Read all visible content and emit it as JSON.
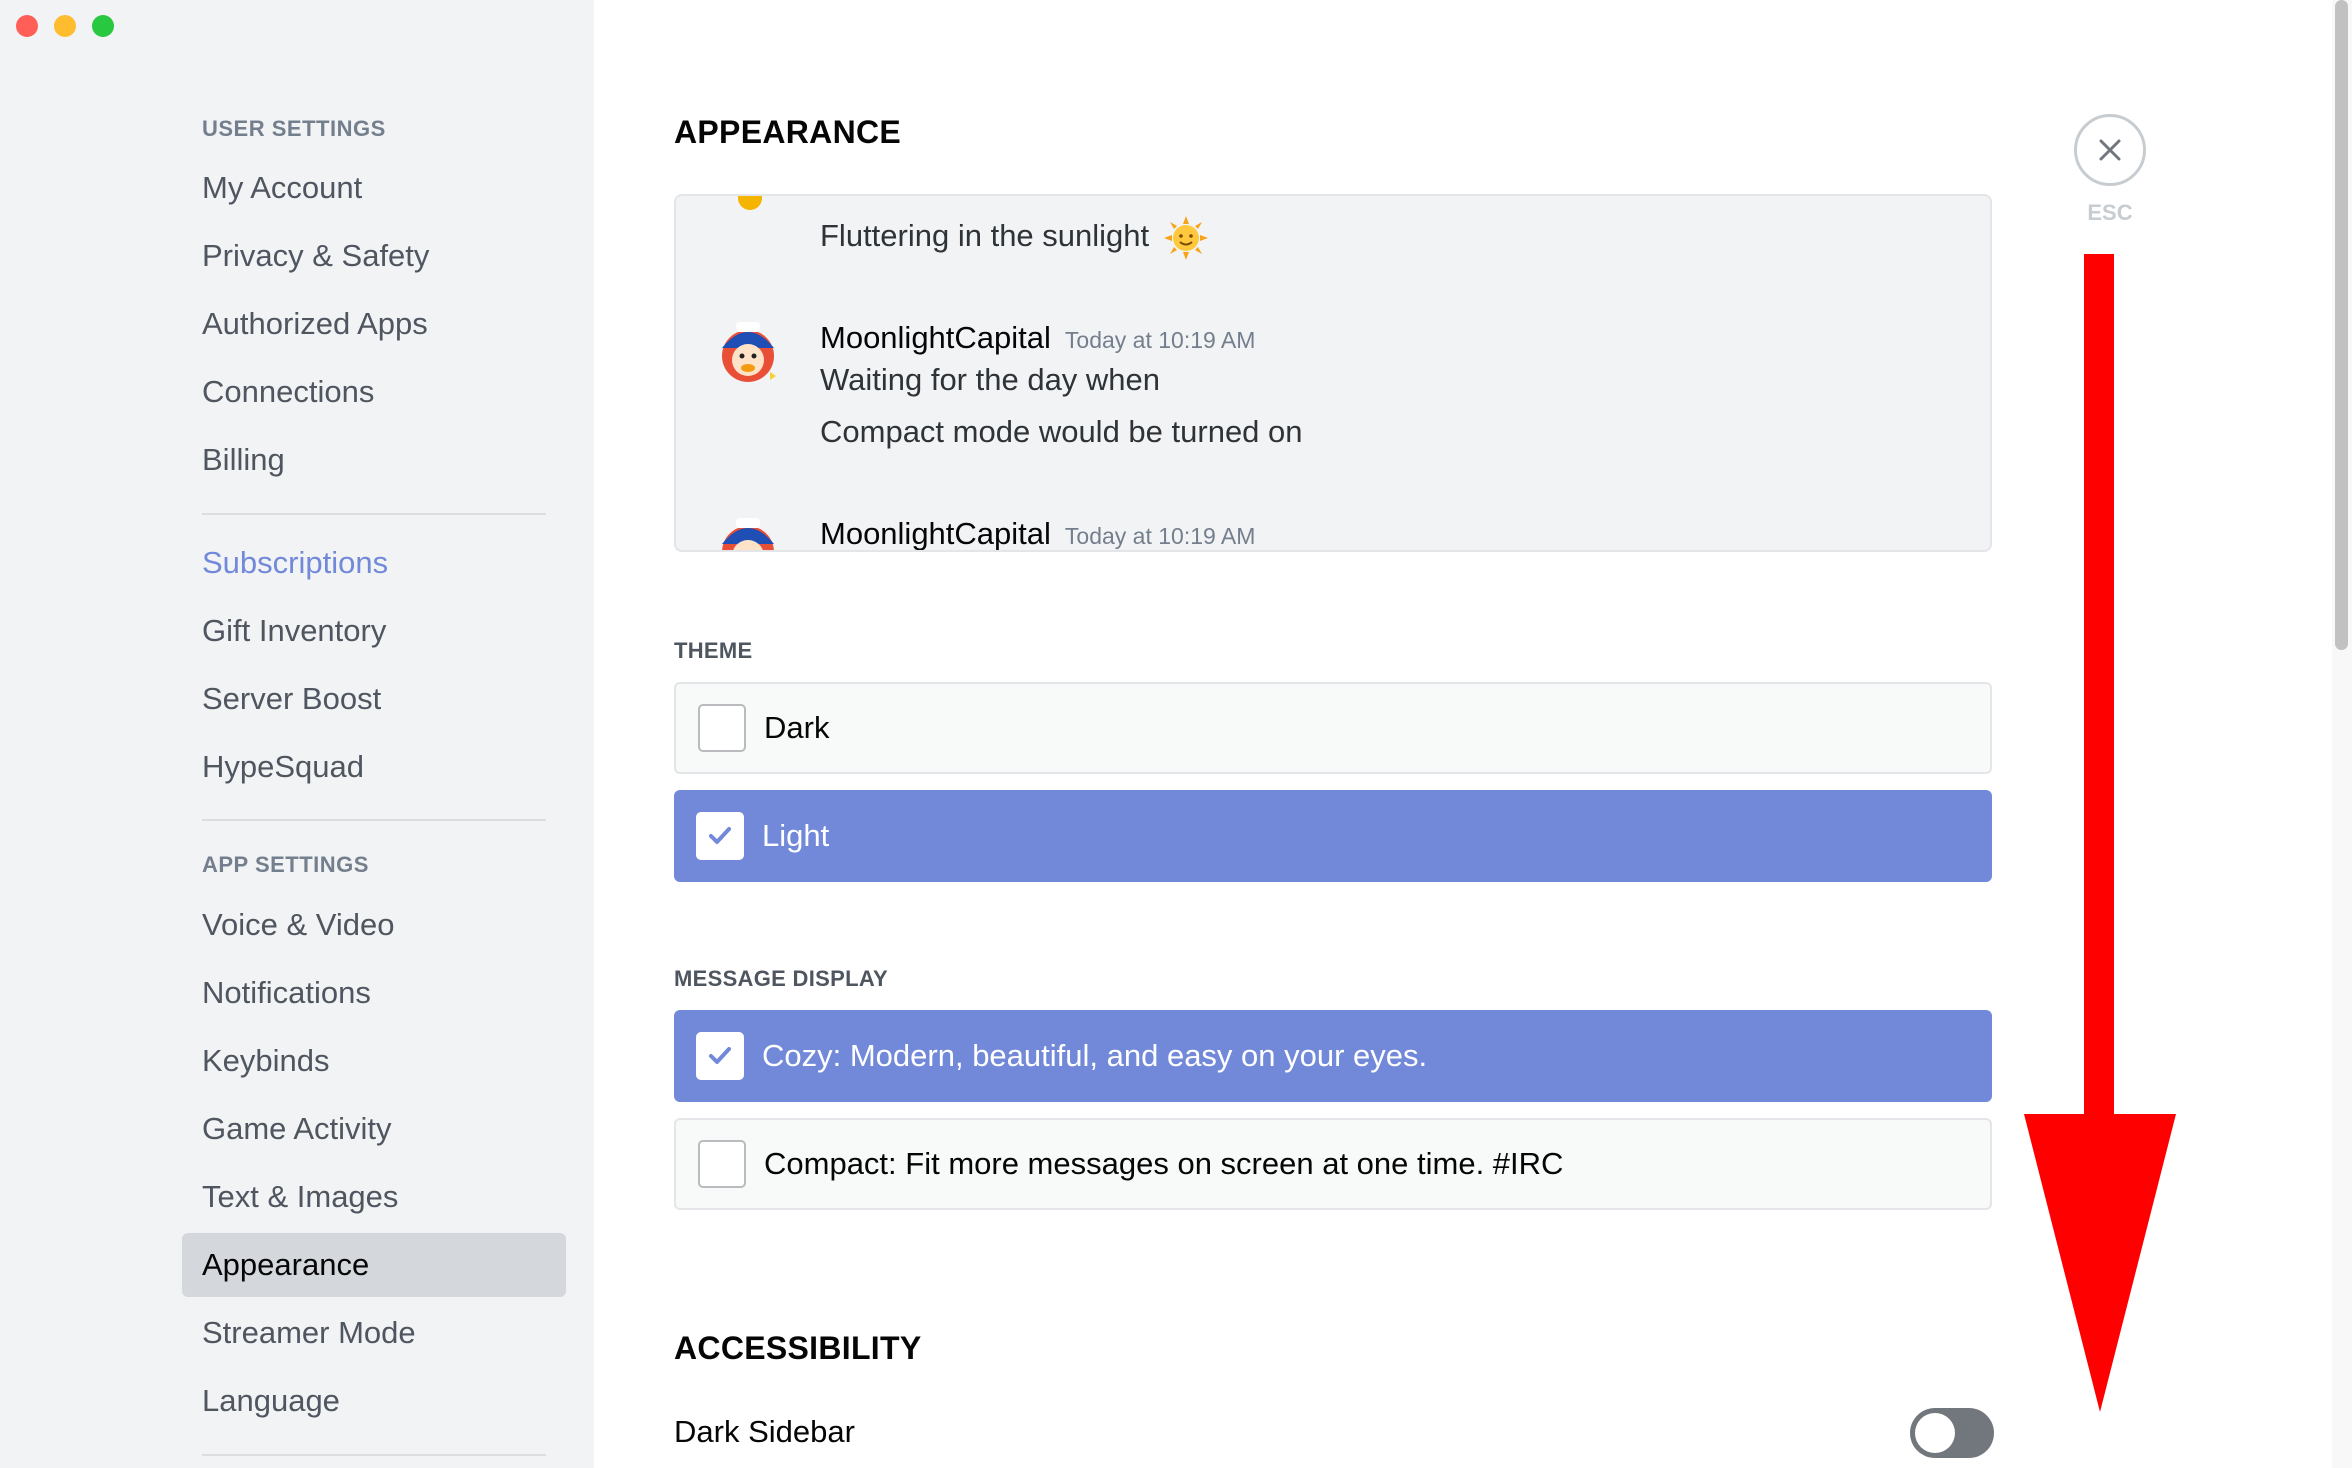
{
  "window": {
    "buttons": [
      "close",
      "minimize",
      "zoom"
    ]
  },
  "sidebar": {
    "user_settings_header": "USER SETTINGS",
    "user_items": [
      "My Account",
      "Privacy & Safety",
      "Authorized Apps",
      "Connections",
      "Billing"
    ],
    "billing_items": [
      "Subscriptions",
      "Gift Inventory",
      "Server Boost",
      "HypeSquad"
    ],
    "app_settings_header": "APP SETTINGS",
    "app_items": [
      "Voice & Video",
      "Notifications",
      "Keybinds",
      "Game Activity",
      "Text & Images",
      "Appearance",
      "Streamer Mode",
      "Language"
    ],
    "selected": "Appearance",
    "accent": "#7289da"
  },
  "main": {
    "appearance_title": "APPEARANCE",
    "preview": {
      "messages": [
        {
          "text": "Fluttering in the sunlight",
          "emoji": "sun-with-face-icon"
        },
        {
          "author": "MoonlightCapital",
          "time": "Today at 10:19 AM",
          "lines": [
            "Waiting for the day when",
            "Compact mode would be turned on"
          ]
        },
        {
          "author": "MoonlightCapital",
          "time": "Today at 10:19 AM"
        }
      ]
    },
    "theme_label": "THEME",
    "theme_options": [
      {
        "label": "Dark",
        "checked": false
      },
      {
        "label": "Light",
        "checked": true
      }
    ],
    "message_display_label": "MESSAGE DISPLAY",
    "display_options": [
      {
        "label": "Cozy: Modern, beautiful, and easy on your eyes.",
        "checked": true
      },
      {
        "label": "Compact: Fit more messages on screen at one time. #IRC",
        "checked": false
      }
    ],
    "accessibility_title": "ACCESSIBILITY",
    "dark_sidebar_label": "Dark Sidebar",
    "dark_sidebar_on": false,
    "close_label": "ESC"
  },
  "annotation": {
    "arrow_color": "#ff0000",
    "direction": "down"
  }
}
